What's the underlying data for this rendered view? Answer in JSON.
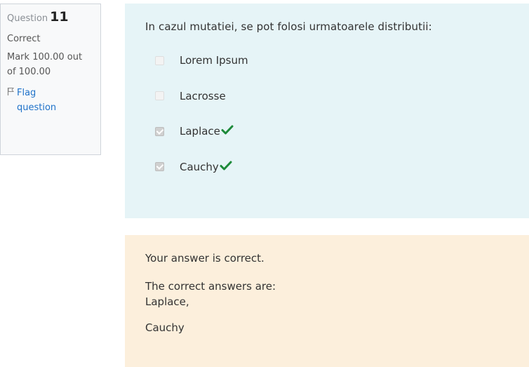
{
  "info": {
    "question_label": "Question",
    "question_number": "11",
    "state": "Correct",
    "grade_line1": "Mark 100.00 out",
    "grade_line2": "of 100.00",
    "flag_label_line1": "Flag",
    "flag_label_line2": "question",
    "flag_icon": "flag-icon"
  },
  "question": {
    "text": "In cazul mutatiei, se pot folosi urmatoarele distributii:",
    "options": [
      {
        "label": "Lorem Ipsum",
        "checked": false,
        "correct": false
      },
      {
        "label": "Lacrosse",
        "checked": false,
        "correct": false
      },
      {
        "label": "Laplace",
        "checked": true,
        "correct": true
      },
      {
        "label": "Cauchy",
        "checked": true,
        "correct": true
      }
    ]
  },
  "feedback": {
    "specific": "Your answer is correct.",
    "right_answer_intro": "The correct answers are:",
    "right_answer_1": "Laplace,",
    "right_answer_2": "Cauchy"
  },
  "colors": {
    "formulation_bg": "#e6f4f7",
    "feedback_bg": "#fcefdc",
    "correct_tick": "#1d8a3a",
    "link": "#1f72c9"
  }
}
